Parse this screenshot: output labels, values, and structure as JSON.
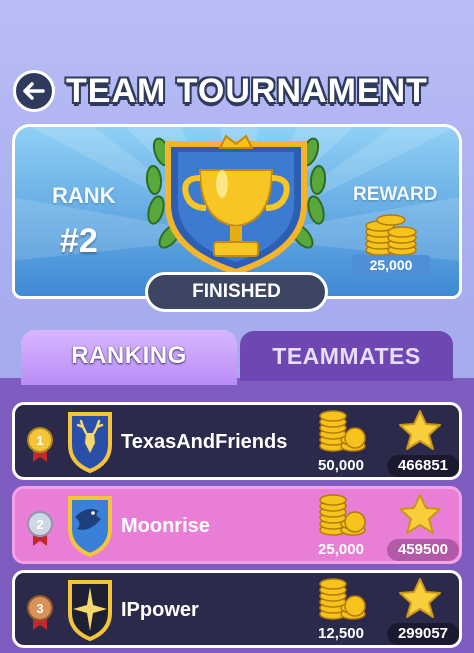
{
  "header": {
    "title": "TEAM TOURNAMENT"
  },
  "banner": {
    "rank_label": "RANK",
    "rank_value": "#2",
    "reward_label": "REWARD",
    "reward_value": "25,000",
    "status": "FINISHED"
  },
  "tabs": [
    {
      "label": "RANKING",
      "active": true
    },
    {
      "label": "TEAMMATES",
      "active": false
    }
  ],
  "rows": [
    {
      "place": "1",
      "team": "TexasAndFriends",
      "coins": "50,000",
      "score": "466851",
      "highlight": false,
      "emblem": "deer-emblem-icon"
    },
    {
      "place": "2",
      "team": "Moonrise",
      "coins": "25,000",
      "score": "459500",
      "highlight": true,
      "emblem": "bird-emblem-icon"
    },
    {
      "place": "3",
      "team": "IPpower",
      "coins": "12,500",
      "score": "299057",
      "highlight": false,
      "emblem": "star-emblem-icon"
    }
  ],
  "colors": {
    "accent": "#7f5cbf",
    "highlight": "#e97ed6",
    "dark_row": "#2c2a4a",
    "gold": "#f6c21c"
  }
}
